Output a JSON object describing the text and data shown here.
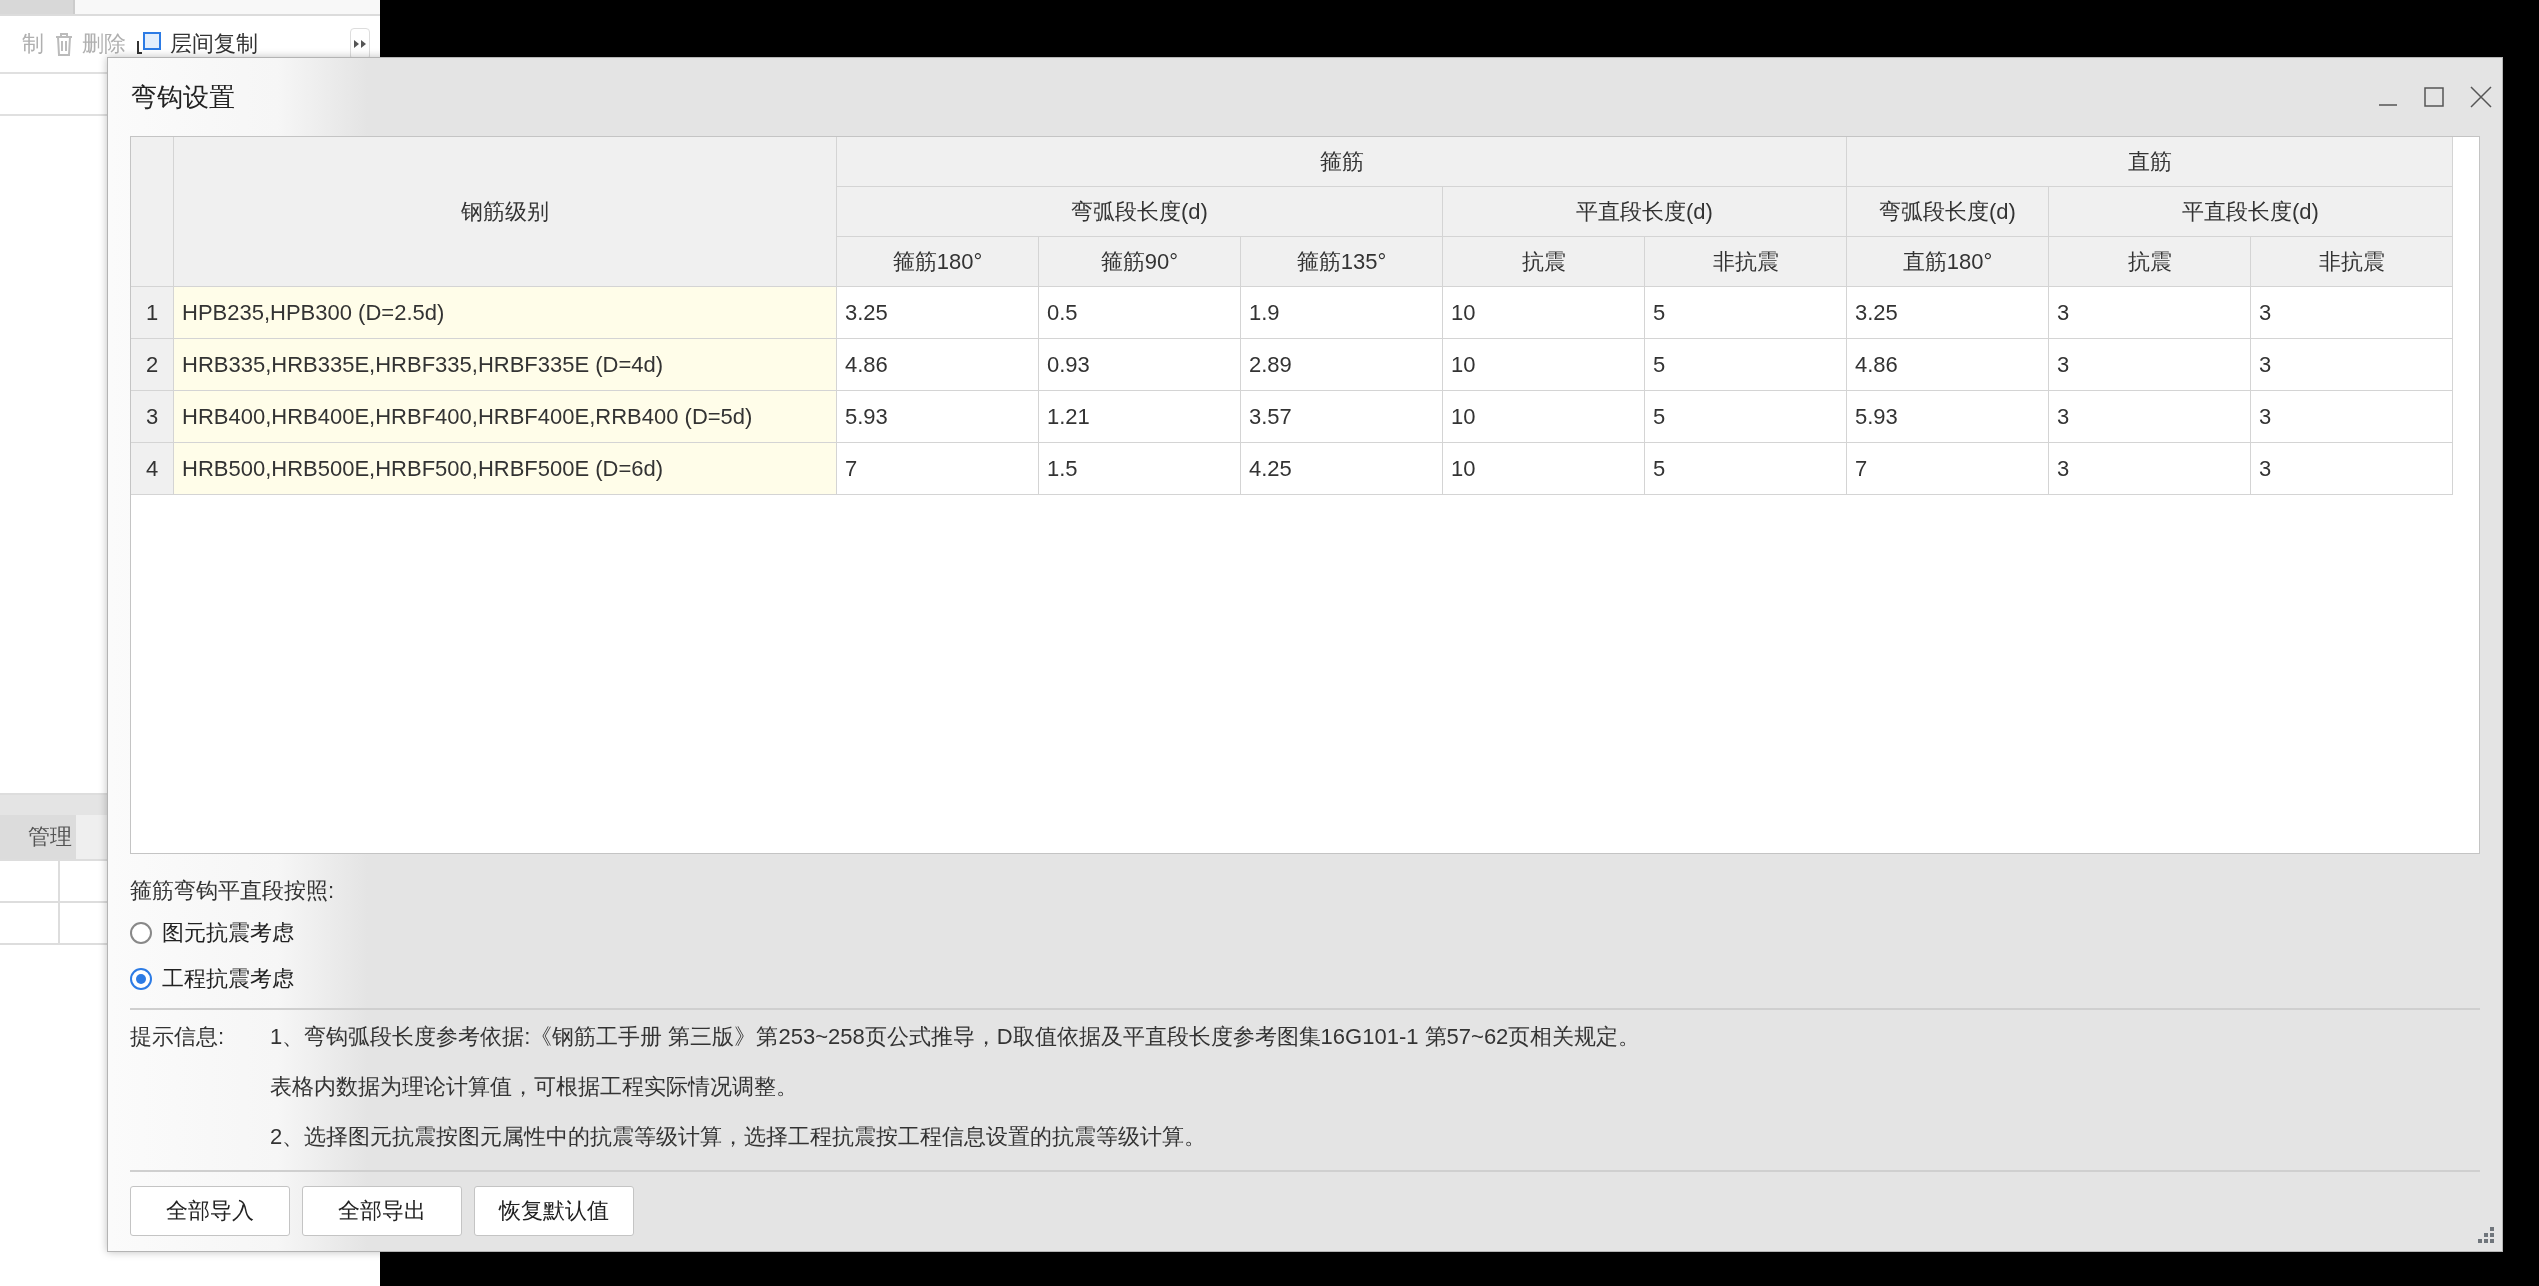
{
  "background_app": {
    "toolbar": [
      {
        "label": "制",
        "kind": "plain",
        "disabled": true
      },
      {
        "label": "删除",
        "kind": "trash",
        "disabled": true
      },
      {
        "label": "层间复制",
        "kind": "copy",
        "disabled": false
      }
    ],
    "lower_tab": "管理"
  },
  "dialog": {
    "title": "弯钩设置",
    "table": {
      "row_header": "钢筋级别",
      "groups": [
        {
          "label": "箍筋",
          "subgroups": [
            {
              "label": "弯弧段长度(d)",
              "columns": [
                "箍筋180°",
                "箍筋90°",
                "箍筋135°"
              ]
            },
            {
              "label": "平直段长度(d)",
              "columns": [
                "抗震",
                "非抗震"
              ]
            }
          ]
        },
        {
          "label": "直筋",
          "subgroups": [
            {
              "label": "弯弧段长度(d)",
              "columns": [
                "直筋180°"
              ]
            },
            {
              "label": "平直段长度(d)",
              "columns": [
                "抗震",
                "非抗震"
              ]
            }
          ]
        }
      ],
      "rows": [
        {
          "number": "1",
          "grade": "HPB235,HPB300 (D=2.5d)",
          "values": [
            "3.25",
            "0.5",
            "1.9",
            "10",
            "5",
            "3.25",
            "3",
            "3"
          ]
        },
        {
          "number": "2",
          "grade": "HRB335,HRB335E,HRBF335,HRBF335E (D=4d)",
          "values": [
            "4.86",
            "0.93",
            "2.89",
            "10",
            "5",
            "4.86",
            "3",
            "3"
          ]
        },
        {
          "number": "3",
          "grade": "HRB400,HRB400E,HRBF400,HRBF400E,RRB400 (D=5d)",
          "values": [
            "5.93",
            "1.21",
            "3.57",
            "10",
            "5",
            "5.93",
            "3",
            "3"
          ]
        },
        {
          "number": "4",
          "grade": "HRB500,HRB500E,HRBF500,HRBF500E (D=6d)",
          "values": [
            "7",
            "1.5",
            "4.25",
            "10",
            "5",
            "7",
            "3",
            "3"
          ]
        }
      ]
    },
    "hook_basis": {
      "label": "箍筋弯钩平直段按照:",
      "options": [
        {
          "label": "图元抗震考虑",
          "selected": false
        },
        {
          "label": "工程抗震考虑",
          "selected": true
        }
      ]
    },
    "info": {
      "label": "提示信息:",
      "lines": [
        "1、弯钩弧段长度参考依据:《钢筋工手册 第三版》第253~258页公式推导，D取值依据及平直段长度参考图集16G101-1 第57~62页相关规定。",
        "表格内数据为理论计算值，可根据工程实际情况调整。",
        "2、选择图元抗震按图元属性中的抗震等级计算，选择工程抗震按工程信息设置的抗震等级计算。"
      ]
    },
    "buttons": [
      "全部导入",
      "全部导出",
      "恢复默认值"
    ]
  }
}
